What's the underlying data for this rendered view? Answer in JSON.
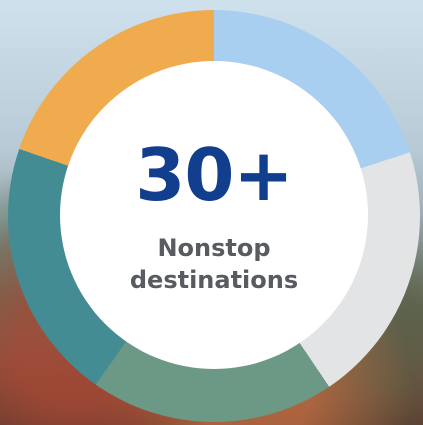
{
  "stat": {
    "value": "30+",
    "label_line1": "Nonstop",
    "label_line2": "destinations"
  },
  "colors": {
    "value_text": "#123e8e",
    "label_text": "#585b60",
    "ring_segments": [
      "#a8cff0",
      "#e2e4e6",
      "#6b9986",
      "#438c93",
      "#efab4d"
    ]
  }
}
